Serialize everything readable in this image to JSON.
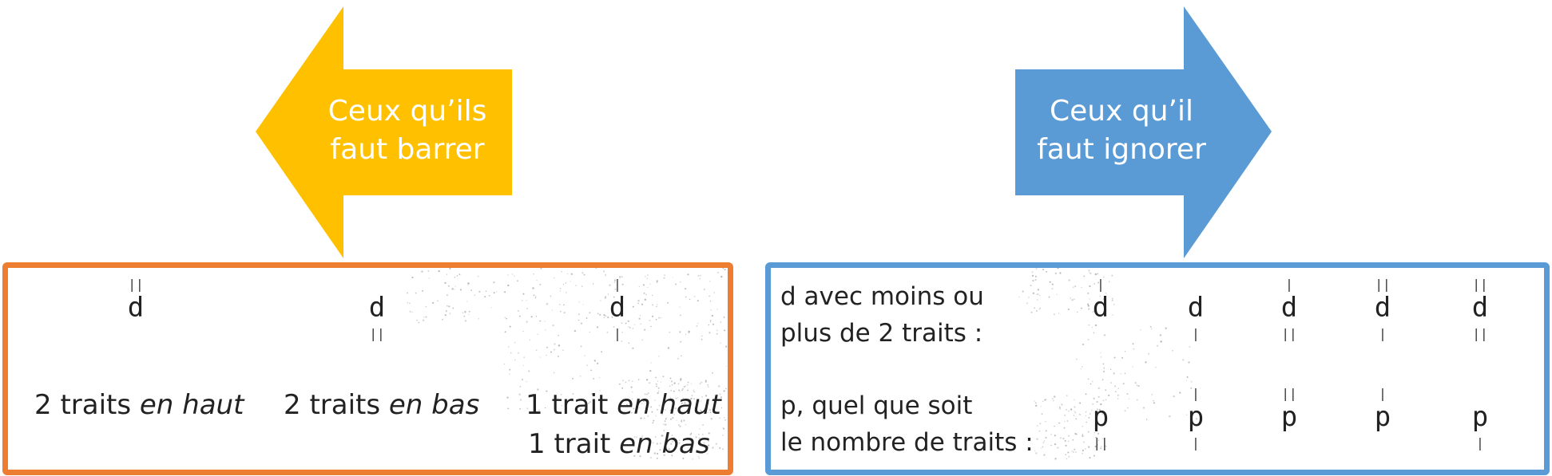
{
  "arrows": {
    "left": {
      "line1": "Ceux qu’ils",
      "line2": "faut barrer",
      "color": "#ffc000"
    },
    "right": {
      "line1": "Ceux qu’il",
      "line2": "faut ignorer",
      "color": "#5b9bd5"
    }
  },
  "left_panel": {
    "border_color": "#ed7d31",
    "items": [
      {
        "top_ticks": "||",
        "letter": "d",
        "bottom_ticks": "",
        "caption_plain": "2 traits ",
        "caption_italic": "en haut",
        "caption2_plain": "",
        "caption2_italic": ""
      },
      {
        "top_ticks": "",
        "letter": "d",
        "bottom_ticks": "||",
        "caption_plain": "2 traits ",
        "caption_italic": "en bas",
        "caption2_plain": "",
        "caption2_italic": ""
      },
      {
        "top_ticks": "|",
        "letter": "d",
        "bottom_ticks": "|",
        "caption_plain": "1 trait ",
        "caption_italic": "en haut",
        "caption2_plain": "1 trait ",
        "caption2_italic": "en bas"
      }
    ]
  },
  "right_panel": {
    "border_color": "#5b9bd5",
    "row1_label": [
      "d avec moins ou",
      "plus de 2 traits :"
    ],
    "row2_label": [
      "p, quel que soit",
      "le nombre de traits :"
    ],
    "row1": [
      {
        "top": "|",
        "letter": "d",
        "bottom": ""
      },
      {
        "top": "",
        "letter": "d",
        "bottom": "|"
      },
      {
        "top": "|",
        "letter": "d",
        "bottom": "||"
      },
      {
        "top": "||",
        "letter": "d",
        "bottom": "|"
      },
      {
        "top": "||",
        "letter": "d",
        "bottom": "||"
      }
    ],
    "row2": [
      {
        "top": "",
        "letter": "p",
        "bottom": "||"
      },
      {
        "top": "|",
        "letter": "p",
        "bottom": "|"
      },
      {
        "top": "||",
        "letter": "p",
        "bottom": ""
      },
      {
        "top": "|",
        "letter": "p",
        "bottom": ""
      },
      {
        "top": "",
        "letter": "p",
        "bottom": "|"
      }
    ]
  }
}
